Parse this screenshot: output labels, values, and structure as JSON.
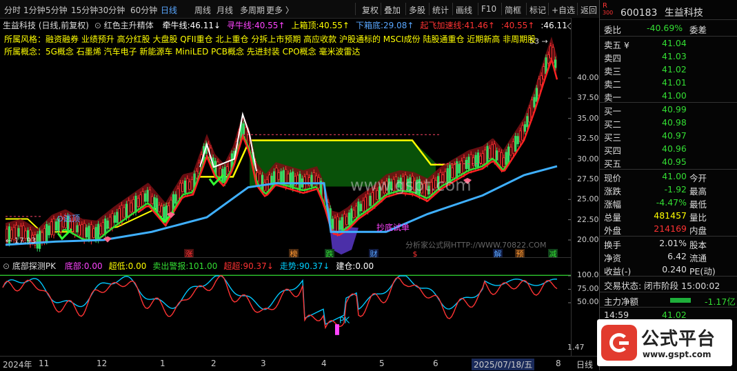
{
  "toolbar": {
    "left_items": [
      "分时",
      "1分钟",
      "5分钟",
      "15分钟",
      "30分钟",
      "60分钟",
      "日线",
      "周线",
      "月线",
      "多周期",
      "更多 〉"
    ],
    "active": "日线",
    "right_items": [
      "复权",
      "叠加",
      "多股",
      "统计",
      "画线",
      "F10",
      "简框",
      "标记",
      "+自选",
      "返回"
    ]
  },
  "main_header": {
    "stock": "生益科技 (日线,前复权)",
    "indicator": "红色主升精体",
    "vals": [
      {
        "name": "牵牛线:",
        "value": "46.11",
        "arrow": "↓",
        "color": "#ffffff"
      },
      {
        "name": "寻牛线:",
        "value": "40.55",
        "arrow": "↑",
        "color": "#ff44ff"
      },
      {
        "name": "上箱顶:",
        "value": "40.55",
        "arrow": "↑",
        "color": "#ffff00"
      },
      {
        "name": "下箱底:",
        "value": "29.08",
        "arrow": "↑",
        "color": "#59a7ff"
      },
      {
        "name": "起飞加速线:",
        "value": "41.46",
        "arrow": "↑",
        "color": "#ff3333"
      },
      {
        "name": ":",
        "value": "40.55",
        "arrow": "↑",
        "color": "#ff3333"
      },
      {
        "name": ":",
        "value": "46.11",
        "arrow": "◇",
        "color": "#ffffff"
      }
    ]
  },
  "style_line": "所属风格：融资融券  业绩预升  高分红股  大盘股  QFII重仓  北上重仓  分拆上市预期  高应收款  沪股通标的  MSCI成份  陆股通重仓  近期新高  非周期股",
  "concept_line": "所属概念：5G概念  石墨烯  汽车电子  新能源车  MiniLED  PCB概念  先进封装  CPO概念  毫米波雷达",
  "annotations": {
    "escape_top": "⊙逃顶",
    "bottom_buy": "抄底试单",
    "low_price": "17.93",
    "high_price": "53",
    "watermark": "www.gspt.com",
    "copyright": "分析家公式网HTTP://WWW.70822.COM"
  },
  "event_markers": [
    {
      "text": "涨",
      "color": "#ff3333",
      "bg": "#4a1010"
    },
    {
      "text": "榜",
      "color": "#ff9933",
      "bg": "#4a2a10"
    },
    {
      "text": "跌",
      "color": "#33dd33",
      "bg": "#10401a"
    },
    {
      "text": "财",
      "color": "#59a7ff",
      "bg": "#101a40"
    },
    {
      "text": "$",
      "color": "#ff3333",
      "bg": "#000"
    },
    {
      "text": "解",
      "color": "#59a7ff",
      "bg": "#101a40"
    },
    {
      "text": "预",
      "color": "#ff9933",
      "bg": "#4a2a10"
    },
    {
      "text": "减",
      "color": "#33dd33",
      "bg": "#10401a"
    }
  ],
  "sub_header": {
    "title": "底部探测PK",
    "vals": [
      {
        "name": "底部:",
        "value": "0.00",
        "color": "#ff44ff"
      },
      {
        "name": "超低:",
        "value": "0.00",
        "color": "#ffff00"
      },
      {
        "name": "卖出警报:",
        "value": "101.00",
        "color": "#33dd33"
      },
      {
        "name": "超超:",
        "value": "90.37",
        "arrow": "↓",
        "color": "#ff3333"
      },
      {
        "name": "走势:",
        "value": "90.37",
        "arrow": "↓",
        "color": "#00d0ff"
      },
      {
        "name": "建仓:",
        "value": "0.00",
        "color": "#ffffff"
      }
    ],
    "pk_label": "PK"
  },
  "price_axis": [
    "40.00",
    "37.50",
    "35.00",
    "32.50",
    "30.00",
    "27.50",
    "25.00",
    "22.50",
    "20.00"
  ],
  "sub_axis": [
    "100.0",
    "75.00",
    "50.00"
  ],
  "sub_axis_bottom": "1.47",
  "time_axis": [
    "2024年",
    "11",
    "12",
    "1",
    "2",
    "3",
    "4",
    "5",
    "6",
    "2025/07/18/五",
    "8"
  ],
  "time_axis_right": "日线",
  "panel": {
    "badge": "R",
    "badge_sub": "300",
    "code": "600183",
    "name": "生益科技",
    "weibi_label": "委比",
    "weibi_value": "-40.69%",
    "weicha_label": "委差",
    "sells": [
      {
        "label": "卖五",
        "mark": "¥",
        "price": "41.04"
      },
      {
        "label": "卖四",
        "price": "41.03"
      },
      {
        "label": "卖三",
        "price": "41.02"
      },
      {
        "label": "卖二",
        "price": "41.01"
      },
      {
        "label": "卖一",
        "price": "41.00"
      }
    ],
    "buys": [
      {
        "label": "买一",
        "price": "40.99"
      },
      {
        "label": "买二",
        "price": "40.98"
      },
      {
        "label": "买三",
        "price": "40.97"
      },
      {
        "label": "买四",
        "price": "40.96"
      },
      {
        "label": "买五",
        "price": "40.95"
      }
    ],
    "quotes": [
      {
        "l1": "现价",
        "v1": "41.00",
        "c1": "#33dd33",
        "l2": "今开",
        "v2": ""
      },
      {
        "l1": "涨跌",
        "v1": "-1.92",
        "c1": "#33dd33",
        "l2": "最高",
        "v2": ""
      },
      {
        "l1": "涨幅",
        "v1": "-4.47%",
        "c1": "#33dd33",
        "l2": "最低",
        "v2": ""
      },
      {
        "l1": "总量",
        "v1": "481457",
        "c1": "#ffff00",
        "l2": "量比",
        "v2": ""
      },
      {
        "l1": "外盘",
        "v1": "214169",
        "c1": "#ff3333",
        "l2": "内盘",
        "v2": ""
      }
    ],
    "stats": [
      {
        "l1": "换手",
        "v1": "2.01%",
        "l2": "股本"
      },
      {
        "l1": "净资",
        "v1": "6.42",
        "l2": "流通"
      },
      {
        "l1": "收益(-)",
        "v1": "0.240",
        "l2": "PE(动)"
      }
    ],
    "trade_status": "交易状态: 闭市阶段 15:00:02",
    "net_flow_label": "主力净额",
    "net_flow_value": "-1.17亿",
    "ticks": [
      {
        "time": "14:59",
        "price": "41.02"
      },
      {
        "time": "14:59",
        "price": "41.00"
      }
    ]
  },
  "logo": {
    "text": "公式平台",
    "url": "www.gspt.com"
  },
  "colors": {
    "up": "#ff3333",
    "down": "#33dd33",
    "accent": "#59a7ff",
    "yellow": "#ffff00"
  }
}
